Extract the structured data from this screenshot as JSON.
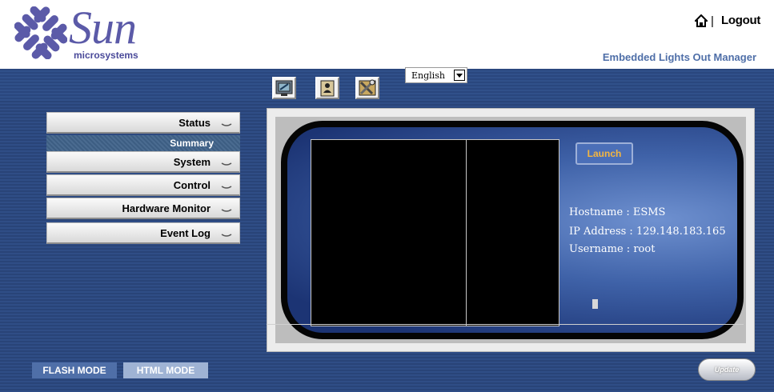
{
  "header": {
    "logo_word": "Sun",
    "logo_sub": "microsystems",
    "separator": "|",
    "logout_label": "Logout",
    "product_name": "Embedded Lights Out Manager",
    "home_icon": "home-icon"
  },
  "toolbar": {
    "tabs": [
      {
        "icon": "remote-console-icon"
      },
      {
        "icon": "user-management-icon"
      },
      {
        "icon": "configuration-tools-icon"
      }
    ],
    "language": "English"
  },
  "menu": {
    "items": [
      {
        "label": "Status"
      },
      {
        "label": "Summary"
      },
      {
        "label": "System"
      },
      {
        "label": "Control"
      },
      {
        "label": "Hardware Monitor"
      },
      {
        "label": "Event Log"
      }
    ]
  },
  "console": {
    "launch_label": "Launch",
    "hostname": "Hostname : ESMS",
    "ip_address": "IP Address : 129.148.183.165",
    "username": "Username : root"
  },
  "footer": {
    "flash_mode_label": "FLASH MODE",
    "html_mode_label": "HTML MODE",
    "update_label": "Update"
  },
  "colors": {
    "band": "#2f4d86",
    "accent": "#4f6fa8",
    "launch_text": "#f4b640"
  }
}
